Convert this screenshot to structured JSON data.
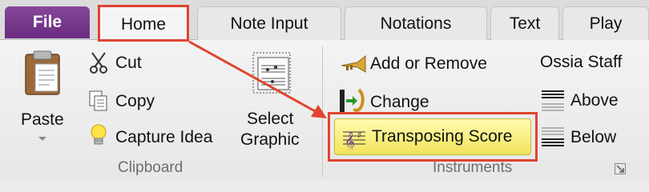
{
  "tabs": {
    "file": "File",
    "home": "Home",
    "note_input": "Note Input",
    "notations": "Notations",
    "text": "Text",
    "play": "Play"
  },
  "clipboard": {
    "paste": "Paste",
    "cut": "Cut",
    "copy": "Copy",
    "capture_idea": "Capture Idea",
    "select_graphic_line1": "Select",
    "select_graphic_line2": "Graphic",
    "group_label": "Clipboard"
  },
  "instruments": {
    "add_or_remove": "Add or Remove",
    "change": "Change",
    "transposing_score": "Transposing Score",
    "ossia_staff": "Ossia Staff",
    "above": "Above",
    "below": "Below",
    "group_label": "Instruments"
  },
  "colors": {
    "file_tab": "#7a3a8f",
    "highlight_box": "#e0442f",
    "active_button": "#f6e86a"
  },
  "icons": [
    "paste-icon",
    "scissors-icon",
    "copy-icon",
    "lightbulb-icon",
    "select-graphic-icon",
    "trumpet-icon",
    "change-instrument-icon",
    "transposing-score-icon",
    "staff-above-icon",
    "staff-below-icon",
    "dialog-launcher-icon",
    "annotation-arrow"
  ]
}
